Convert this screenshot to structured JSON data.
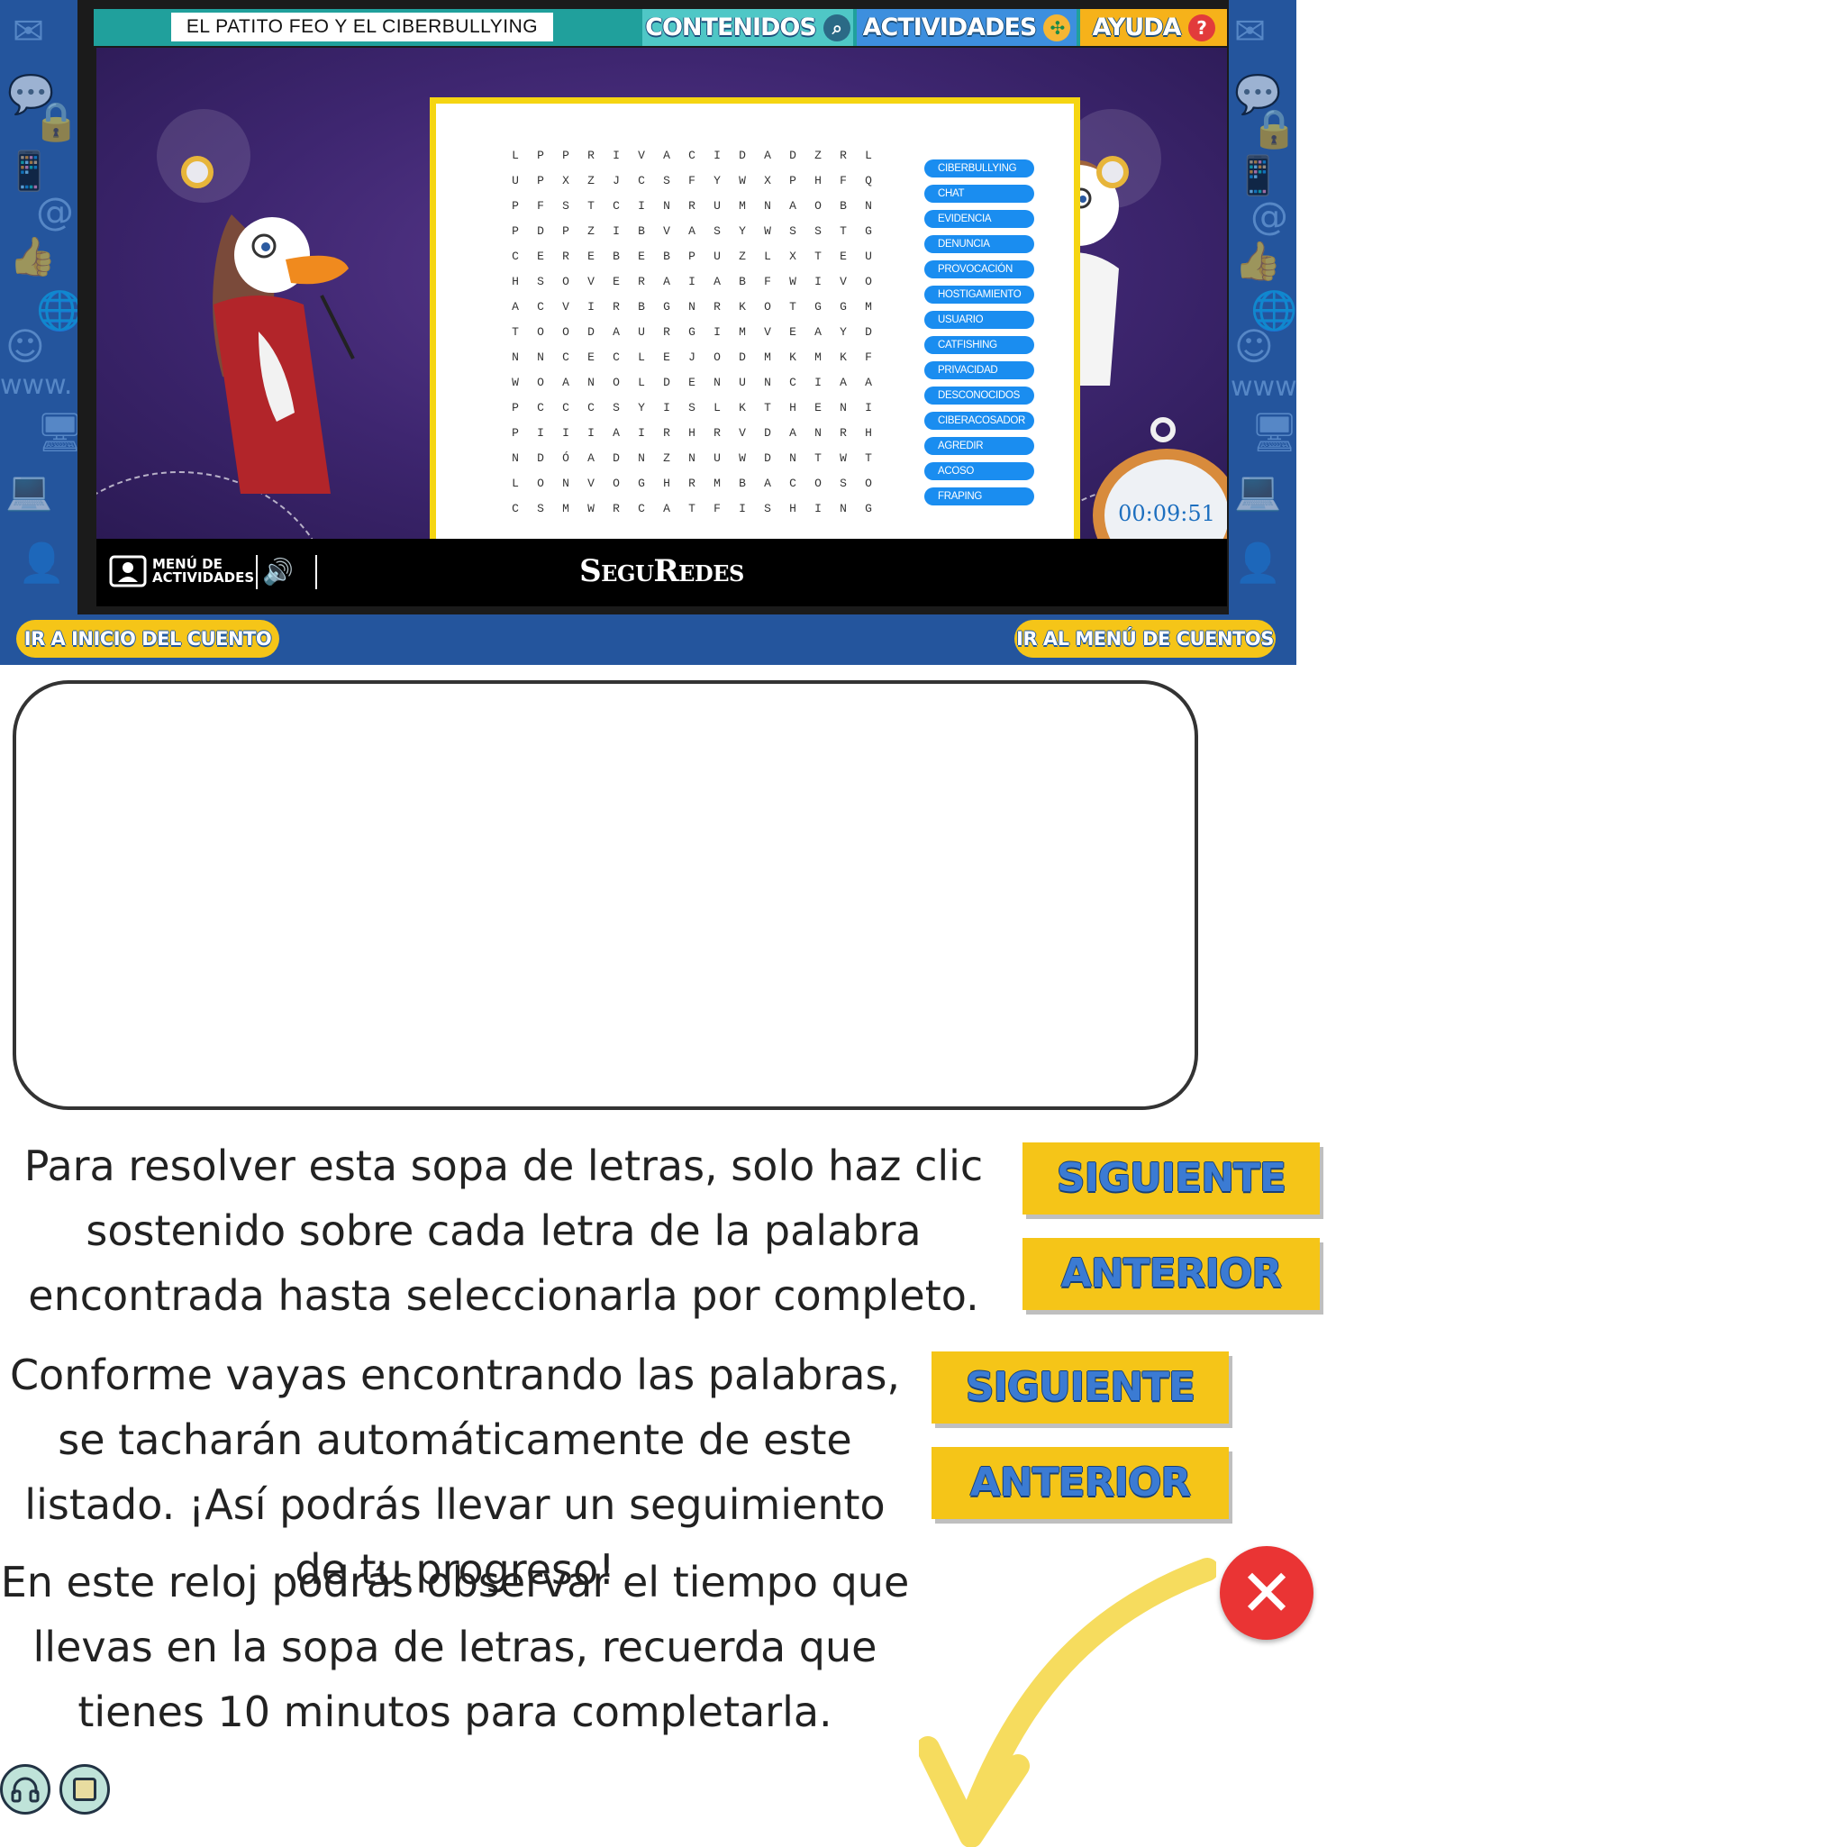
{
  "header": {
    "story_title": "EL PATITO FEO Y EL CIBERBULLYING",
    "nav": {
      "contenidos": "CONTENIDOS",
      "actividades": "ACTIVIDADES",
      "ayuda": "AYUDA"
    }
  },
  "puzzle": {
    "grid": [
      "LPPRIVACIDADZRL",
      "UPXZJCSFYWXPHFQ",
      "PFSTCINRUMNAOBN",
      "PDPZIBVASYWSSTG",
      "CEREBEBPUZLXTEU",
      "HSOVERAIABFWIVO",
      "ACVIRBGNRKOTGGM",
      "TOODAURGIMVEAYD",
      "NNCECLEJODMKMKF",
      "WOANOLDENUNCIAA",
      "PCCCSYISLKTHENI",
      "PIIIAIRHRVDANRH",
      "NDÓADNZNUWDNTWT",
      "LONVOGHRMBACOSO",
      "CSMWRCATFISHING"
    ],
    "words": [
      "CIBERBULLYING",
      "CHAT",
      "EVIDENCIA",
      "DENUNCIA",
      "PROVOCACIÓN",
      "HOSTIGAMIENTO",
      "USUARIO",
      "CATFISHING",
      "PRIVACIDAD",
      "DESCONOCIDOS",
      "CIBERACOSADOR",
      "AGREDIR",
      "ACOSO",
      "FRAPING"
    ],
    "timer": "00:09:51"
  },
  "bottombar": {
    "menu_label_1": "MENÚ DE",
    "menu_label_2": "ACTIVIDADES",
    "brand": "SeguRedes"
  },
  "footer": {
    "inicio": "IR A INICIO DEL CUENTO",
    "menu_cuentos": "IR AL MENÚ DE CUENTOS"
  },
  "help": {
    "text1": "Para resolver esta sopa de letras, solo haz clic sostenido sobre cada letra de la palabra encontrada hasta seleccionarla por completo.",
    "text2": "Conforme vayas encontrando las palabras, se tacharán automáticamente de este listado. ¡Así podrás llevar un seguimiento de tu progreso!",
    "text3": "En este reloj podrás observar el tiempo que llevas en la sopa de letras, recuerda que tienes 10 minutos para completarla.",
    "next": "SIGUIENTE",
    "prev": "ANTERIOR"
  },
  "colors": {
    "frame_blue": "#24559d",
    "stage_purple": "#3e2670",
    "accent_yellow": "#f5c518",
    "word_blue": "#1a8df0"
  }
}
